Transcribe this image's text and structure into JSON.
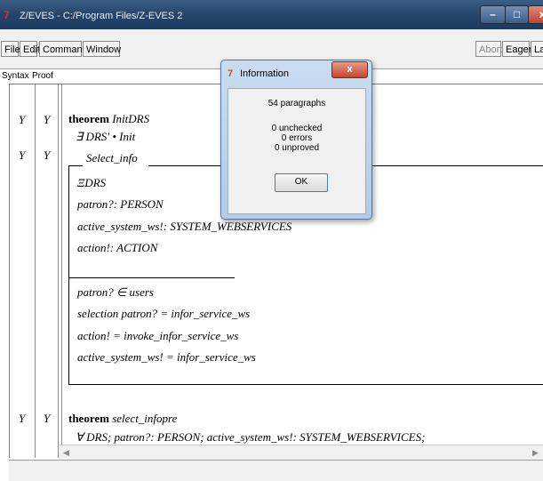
{
  "window": {
    "title": "Z/EVES - C:/Program Files/Z-EVES 2",
    "minimize_label": "–",
    "maximize_label": "□",
    "close_label": "x"
  },
  "menubar": {
    "file": "File",
    "edit": "Edit",
    "command": "Command",
    "window": "Window",
    "abort": "Abort",
    "eager": "Eager",
    "lazy": "La"
  },
  "columns": {
    "syntax": "Syntax",
    "proof": "Proof"
  },
  "flags": {
    "syntax": "Y",
    "proof": "Y"
  },
  "document": {
    "p1": {
      "keyword": "theorem",
      "name": "InitDRS",
      "line2": "∃ DRS' • Init"
    },
    "schema": {
      "name": "Select_info",
      "decls": [
        "ΞDRS",
        "patron?: PERSON",
        "active_system_ws!: SYSTEM_WEBSERVICES",
        "action!: ACTION"
      ],
      "preds": [
        "patron? ∈ users",
        "selection patron? = infor_service_ws",
        "action! = invoke_infor_service_ws",
        "active_system_ws! = infor_service_ws"
      ]
    },
    "p3": {
      "keyword": "theorem",
      "name": "select_infopre",
      "line2": "∀ DRS; patron?: PERSON; active_system_ws!: SYSTEM_WEBSERVICES;"
    }
  },
  "dialog": {
    "title": "Information",
    "close_label": "x",
    "lines": [
      "54 paragraphs",
      "0 unchecked",
      "0 errors",
      "0 unproved"
    ],
    "ok_label": "OK"
  }
}
